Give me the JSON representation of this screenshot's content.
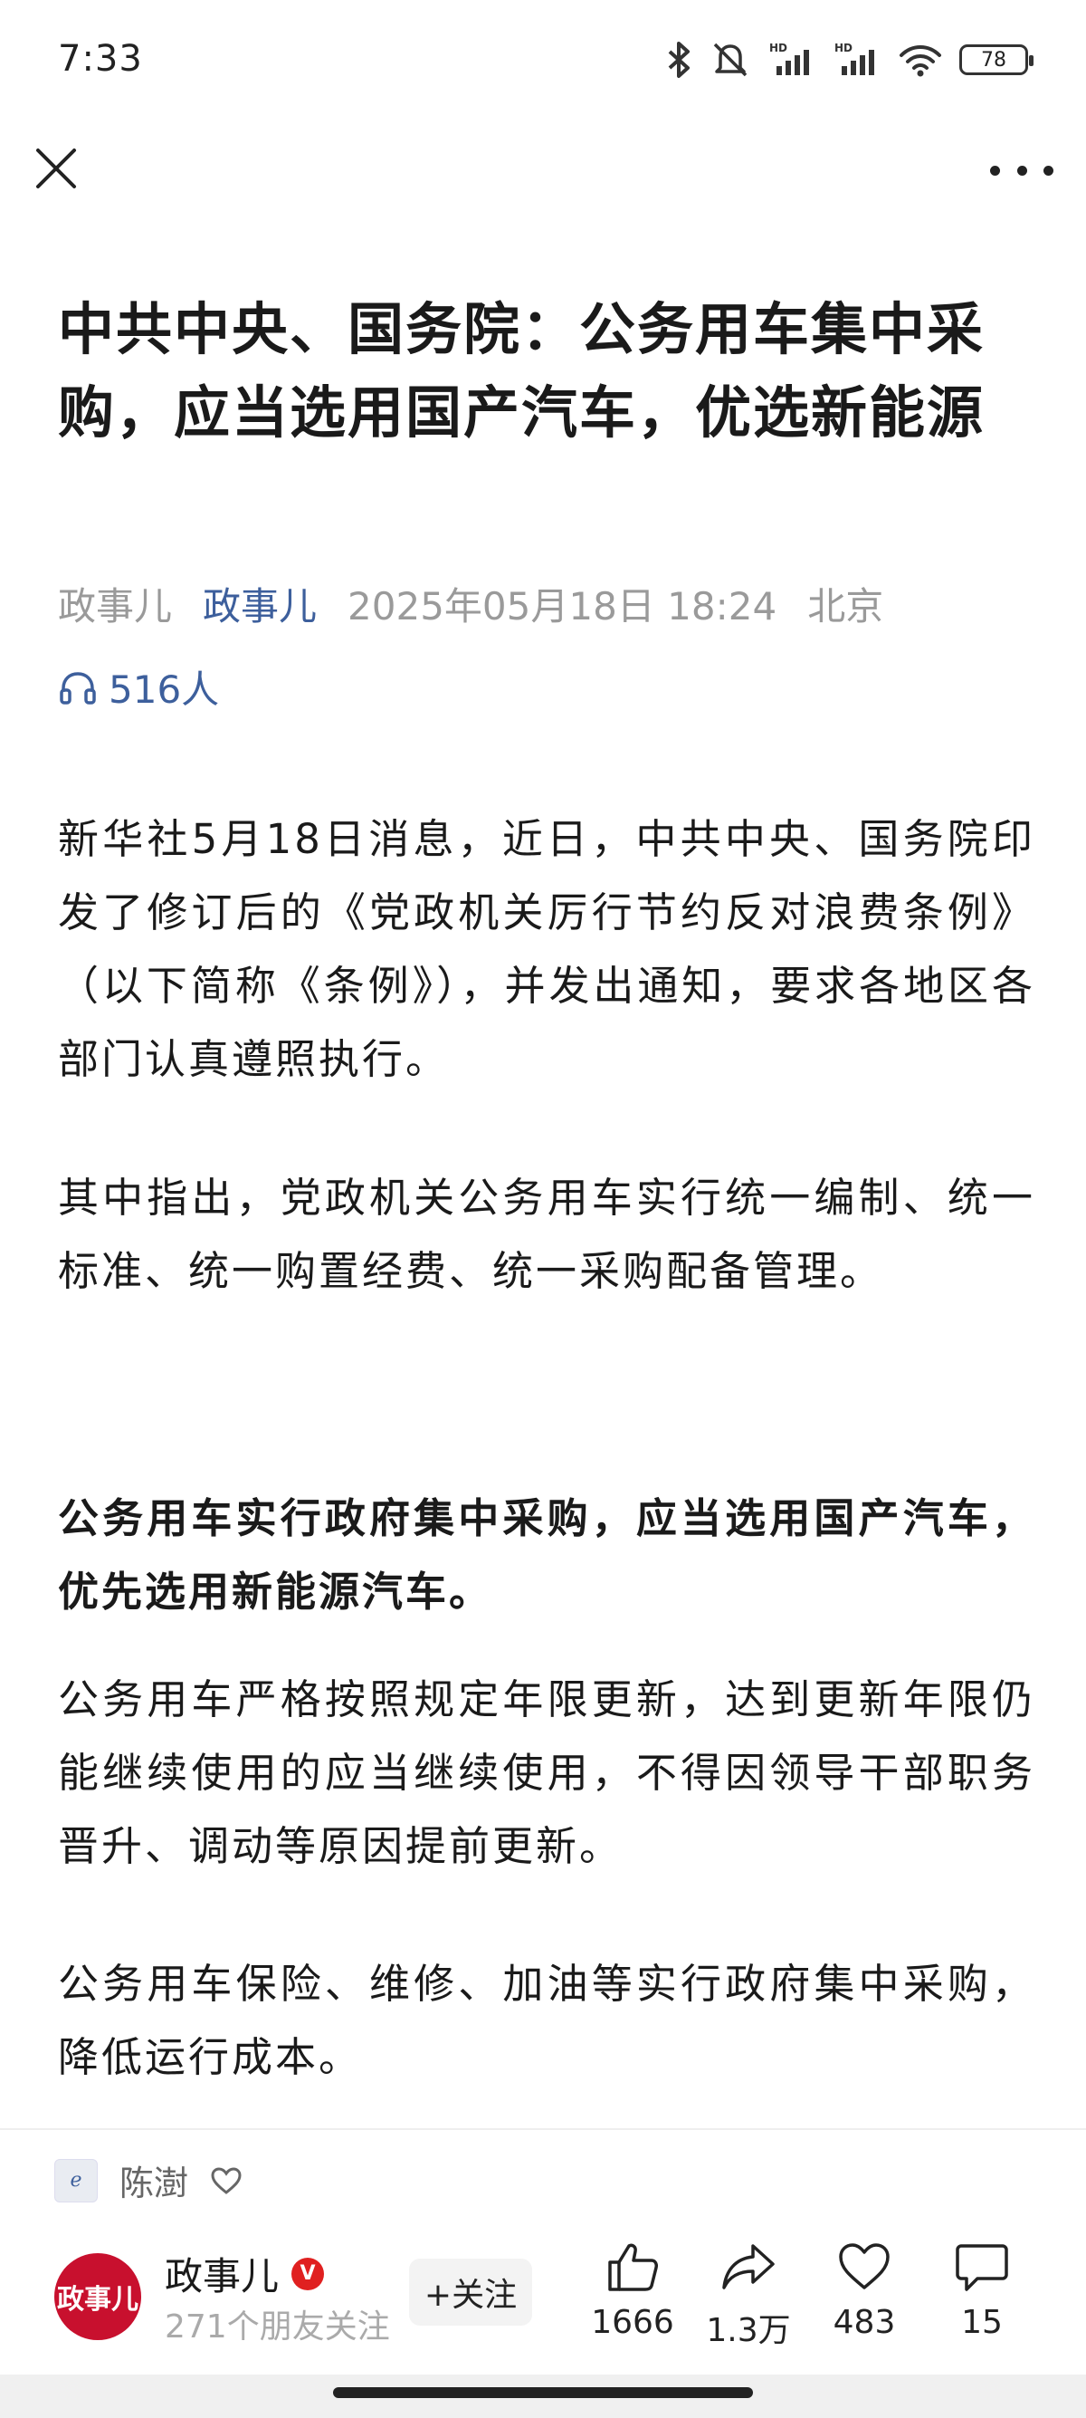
{
  "status_bar": {
    "time": "7:33",
    "battery": "78",
    "icons": [
      "bluetooth-icon",
      "mute-icon",
      "hd-signal-icon",
      "hd-signal-icon",
      "wifi-icon",
      "battery-icon"
    ]
  },
  "top_bar": {
    "close_icon": "close-icon",
    "more_icon": "more-icon"
  },
  "article": {
    "title": "中共中央、国务院：公务用车集中采购，应当选用国产汽车，优选新能源",
    "source": "政事儿",
    "author": "政事儿",
    "datetime": "2025年05月18日 18:24",
    "location": "北京",
    "listeners": "516人",
    "paragraphs": [
      "新华社5月18日消息，近日，中共中央、国务院印发了修订后的《党政机关厉行节约反对浪费条例》（以下简称《条例》），并发出通知，要求各地区各部门认真遵照执行。",
      "其中指出，党政机关公务用车实行统一编制、统一标准、统一购置经费、统一采购配备管理。",
      "公务用车实行政府集中采购，应当选用国产汽车，优先选用新能源汽车。",
      "公务用车严格按照规定年限更新，达到更新年限仍能继续使用的应当继续使用，不得因领导干部职务晋升、调动等原因提前更新。",
      "公务用车保险、维修、加油等实行政府集中采购，降低运行成本。"
    ]
  },
  "editor": {
    "name": "陈澍"
  },
  "account": {
    "name": "政事儿",
    "avatar_text": "政事儿",
    "followers": "271个朋友关注",
    "follow_label": "+关注"
  },
  "actions": {
    "like": "1666",
    "share": "1.3万",
    "favorite": "483",
    "comment": "15"
  },
  "colors": {
    "accent_blue": "#3d5f9c",
    "brand_red": "#c8102e"
  }
}
